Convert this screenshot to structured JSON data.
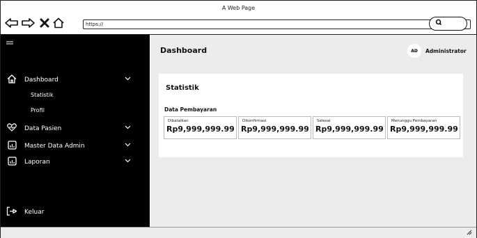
{
  "window": {
    "title": "A Web Page"
  },
  "browser": {
    "url": "https://",
    "icons": [
      "back-arrow-icon",
      "forward-arrow-icon",
      "close-x-icon",
      "home-icon",
      "search-icon"
    ]
  },
  "sidebar": {
    "menu_icon": "hamburger-icon",
    "items": [
      {
        "label": "Dashboard",
        "icon": "home-icon",
        "expandable": true
      },
      {
        "label": "Statistik",
        "sub": true
      },
      {
        "label": "Profil",
        "sub": true
      },
      {
        "label": "Data Pasien",
        "icon": "heart-icon",
        "expandable": true
      },
      {
        "label": "Master Data Admin",
        "icon": "chart-icon",
        "expandable": true
      },
      {
        "label": "Laporan",
        "icon": "chart-icon",
        "expandable": true
      }
    ],
    "logout": {
      "label": "Keluar",
      "icon": "logout-icon"
    }
  },
  "header": {
    "title": "Dashboard",
    "avatar_initials": "AD",
    "user": "Administrator"
  },
  "main": {
    "card_title": "Statistik",
    "section_title": "Data Pembayaran",
    "stats": [
      {
        "label": "Dibatalkan",
        "value": "Rp9,999,999.99"
      },
      {
        "label": "Dikonfirmasi",
        "value": "Rp9,999,999.99"
      },
      {
        "label": "Selesai",
        "value": "Rp9,999,999.99"
      },
      {
        "label": "Menunggu Pembayaran",
        "value": "Rp9,999,999.99"
      }
    ]
  }
}
